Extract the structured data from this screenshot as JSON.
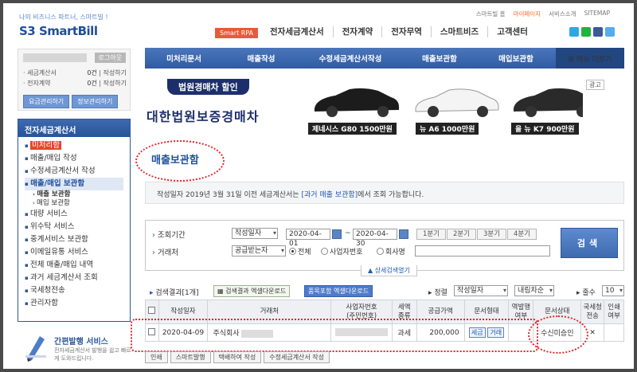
{
  "header": {
    "slogan": "나의 비즈니스 파트너, 스마트빌 !",
    "logo_prefix": "S3",
    "logo_text": "SmartBill",
    "util_links": [
      "스마트빌 홈",
      "마이페이지",
      "서비스소개",
      "SITEMAP"
    ],
    "rpa_badge": "Smart RPA",
    "gnb": [
      "전자세금계산서",
      "전자계약",
      "전자무역",
      "스마트비즈",
      "고객센터"
    ],
    "sns_colors": [
      "#2ea9e0",
      "#1eb43a",
      "#3b5998",
      "#55acee"
    ]
  },
  "login": {
    "logout": "로그아웃",
    "rows": [
      {
        "label": "· 세금계산서",
        "count": "0건",
        "action": "작성하기"
      },
      {
        "label": "· 전자계약",
        "count": "0건",
        "action": "작성하기"
      }
    ],
    "buttons": [
      "요금관리하기",
      "정보관리하기"
    ]
  },
  "sidebar": {
    "title": "전자세금계산서",
    "items": [
      {
        "label": "미처리함",
        "type": "unpr"
      },
      {
        "label": "매출/매입 작성",
        "type": ""
      },
      {
        "label": "수정세금계산서 작성",
        "type": ""
      },
      {
        "label": "매출/매입 보관함",
        "type": "active"
      },
      {
        "label": "매출 보관함",
        "type": "sub subactive"
      },
      {
        "label": "매입 보관함",
        "type": "sub"
      },
      {
        "label": "대량 서비스",
        "type": ""
      },
      {
        "label": "위수탁 서비스",
        "type": ""
      },
      {
        "label": "중계서비스 보관함",
        "type": ""
      },
      {
        "label": "이메일유통 서비스",
        "type": ""
      },
      {
        "label": "전체 매출/매입 내역",
        "type": ""
      },
      {
        "label": "과거 세금계산서 조회",
        "type": ""
      },
      {
        "label": "국세청전송",
        "type": ""
      },
      {
        "label": "관리자함",
        "type": ""
      }
    ]
  },
  "helper": {
    "title": "간편발행 서비스",
    "desc": "전자세금계산서 발행을 쉽고 빠르게 도와드립니다."
  },
  "subnav": {
    "items": [
      "미처리문서",
      "매출작성",
      "수정세금계산서작성",
      "매출보관함",
      "매입보관함"
    ],
    "more": "⊞ 메뉴 더보기"
  },
  "banner": {
    "pill": "법원경매차 할인",
    "main": "대한법원보증경매차",
    "cars": [
      "제네시스 G80 1500만원",
      "뉴 A6 1000만원",
      "올 뉴 K7 900만원"
    ],
    "ad": "광고"
  },
  "page_title": "매출보관함",
  "notice": {
    "before": "작성일자 2019년 3월 31일 이전 세금계산서는 ",
    "link": "[과거 매출 보관함]",
    "after": "에서 조회 가능합니다."
  },
  "search": {
    "period_label": "조회기간",
    "period_type": "작성일자",
    "date_from": "2020-04-01",
    "date_to": "2020-04-30",
    "quarters": [
      "1분기",
      "2분기",
      "3분기",
      "4분기"
    ],
    "partner_label": "거래처",
    "partner_type": "공급받는자",
    "radios": [
      "전체",
      "사업자번호",
      "회사명"
    ],
    "detail_toggle": "▲ 상세검색열기",
    "button": "검색"
  },
  "results": {
    "count": "검색결과[1개]",
    "excel": "검색결과 엑셀다운로드",
    "excel_items": "품목포함 엑셀다운로드",
    "sort_label": "▸ 정렬",
    "sort_value": "작성일자",
    "order_value": "내림차순",
    "rows_label": "▸ 줄수",
    "rows_value": "10"
  },
  "table": {
    "headers": [
      "",
      "작성일자",
      "거래처",
      "사업자번호\n(주민번호)",
      "세액\n종류",
      "공급가액",
      "문서형태",
      "역발행\n여부",
      "문서상태",
      "국세청\n전송",
      "인쇄\n여부"
    ],
    "rows": [
      {
        "date": "2020-04-09",
        "partner": "주식회사",
        "tax_type": "과세",
        "amount": "200,000",
        "doc_tags": [
          "세금",
          "거래"
        ],
        "status": "수신미승인",
        "nts": "✕"
      }
    ]
  },
  "bottom_buttons": [
    "인쇄",
    "스마트발행",
    "택배하여 작성",
    "수정세금계산서 작성"
  ]
}
